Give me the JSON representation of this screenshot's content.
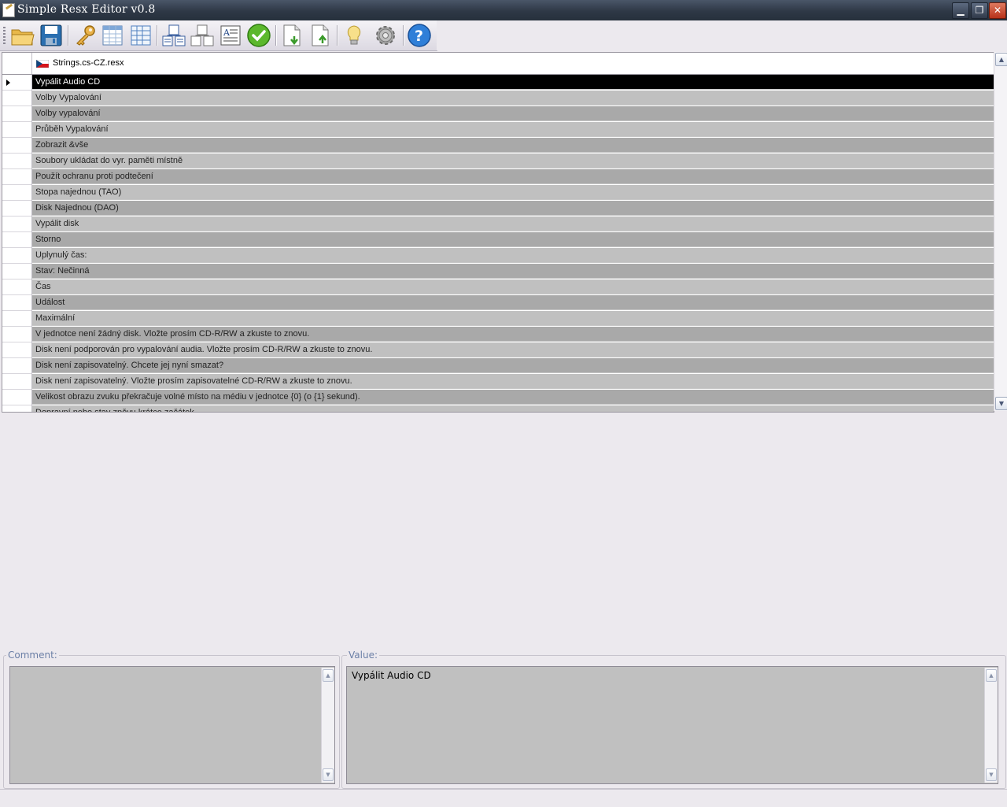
{
  "window": {
    "title": "Simple Resx Editor v0.8",
    "controls": [
      "minimize",
      "maximize",
      "close"
    ]
  },
  "toolbar": {
    "buttons": [
      {
        "name": "open-folder-icon"
      },
      {
        "name": "save-icon"
      },
      {
        "name": "key-icon"
      },
      {
        "name": "grid-view-icon"
      },
      {
        "name": "table-icon"
      },
      {
        "name": "multi-document-icon"
      },
      {
        "name": "tree-document-icon"
      },
      {
        "name": "text-document-icon"
      },
      {
        "name": "check-icon"
      },
      {
        "name": "import-document-icon"
      },
      {
        "name": "export-document-icon"
      },
      {
        "name": "lightbulb-icon"
      },
      {
        "name": "settings-gear-icon"
      },
      {
        "name": "help-icon"
      }
    ]
  },
  "grid": {
    "column_header": "Strings.cs-CZ.resx",
    "rows": [
      "Vypálit Audio CD",
      "Volby Vypalování",
      "Volby vypalování",
      "Průběh Vypalování",
      "Zobrazit &vše",
      "Soubory ukládat do vyr. paměti místně",
      "Použít ochranu proti podtečení",
      "Stopa najednou (TAO)",
      "Disk Najednou (DAO)",
      "Vypálit disk",
      "Storno",
      "Uplynulý čas:",
      "Stav: Nečinná",
      "Čas",
      "Událost",
      "Maximální",
      "V jednotce není žádný disk. Vložte prosím CD-R/RW a zkuste to znovu.",
      "Disk není podporován pro vypalování audia. Vložte prosím CD-R/RW a zkuste to znovu.",
      "Disk není zapisovatelný. Chcete jej nyní smazat?",
      "Disk není zapisovatelný. Vložte prosím zapisovatelné CD-R/RW a zkuste to znovu.",
      "Velikost obrazu zvuku překračuje volné místo na médiu v jednotce {0} (o {1} sekund).",
      "Dopravní nebo stav zpěvu krátce začátek"
    ],
    "selected_index": 0
  },
  "comment": {
    "label": "Comment:",
    "value": ""
  },
  "value_panel": {
    "label": "Value:",
    "value": "Vypálit Audio CD"
  }
}
